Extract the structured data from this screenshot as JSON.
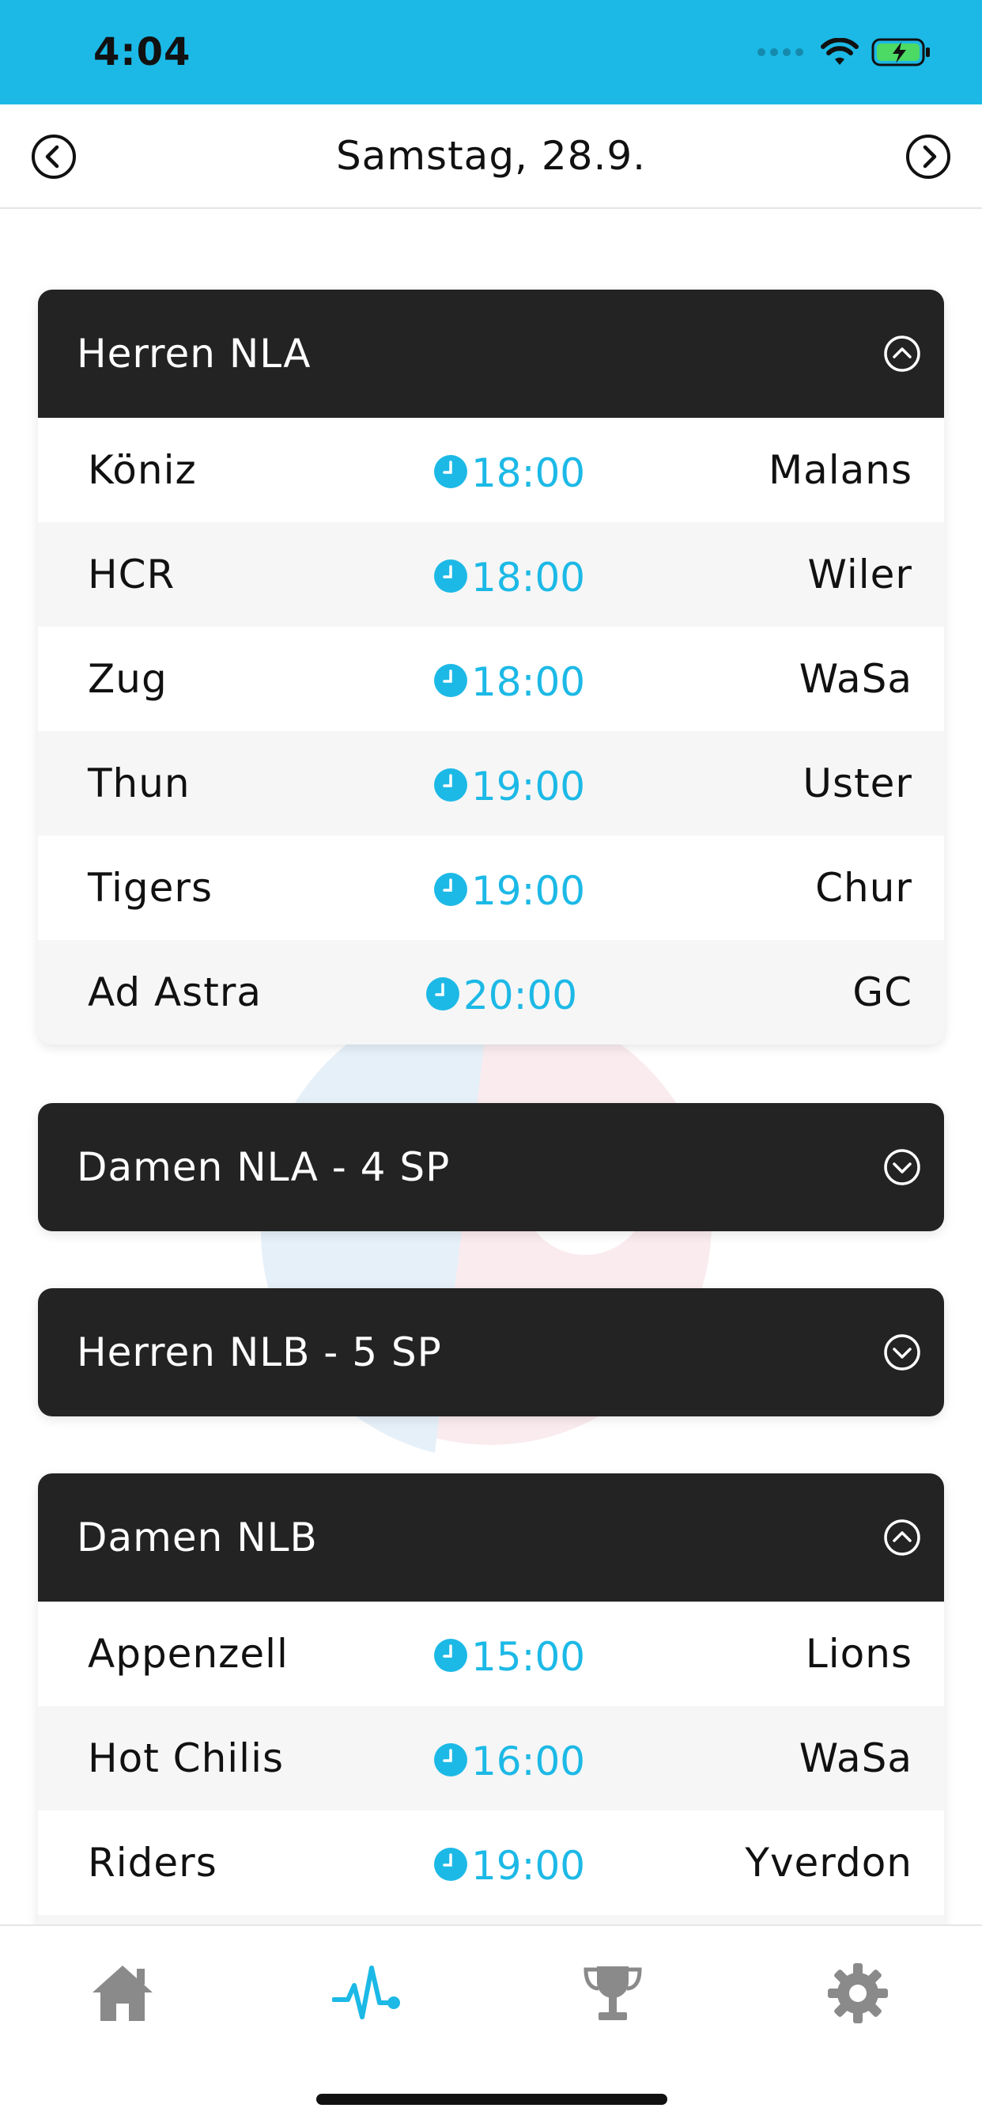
{
  "status_bar": {
    "time": "4:04",
    "icons": [
      "cellular-dots-icon",
      "wifi-icon",
      "battery-charging-icon"
    ],
    "background_color": "#1cb9e6"
  },
  "date_nav": {
    "title": "Samstag, 28.9.",
    "prev_icon": "chevron-left-circle-icon",
    "next_icon": "chevron-right-circle-icon"
  },
  "colors": {
    "accent": "#1cb9e6",
    "header_dark": "#232323",
    "inactive_tab": "#8a8a8a"
  },
  "leagues": [
    {
      "title": "Herren NLA",
      "expanded": true,
      "toggle_icon": "chevron-up-circle-icon",
      "matches": [
        {
          "home": "Köniz",
          "time": "18:00",
          "away": "Malans"
        },
        {
          "home": "HCR",
          "time": "18:00",
          "away": "Wiler"
        },
        {
          "home": "Zug",
          "time": "18:00",
          "away": "WaSa"
        },
        {
          "home": "Thun",
          "time": "19:00",
          "away": "Uster"
        },
        {
          "home": "Tigers",
          "time": "19:00",
          "away": "Chur"
        },
        {
          "home": "Ad Astra",
          "time": "20:00",
          "away": "GC"
        }
      ]
    },
    {
      "title": "Damen NLA - 4 SP",
      "expanded": false,
      "toggle_icon": "chevron-down-circle-icon",
      "matches": []
    },
    {
      "title": "Herren NLB - 5 SP",
      "expanded": false,
      "toggle_icon": "chevron-down-circle-icon",
      "matches": []
    },
    {
      "title": "Damen NLB",
      "expanded": true,
      "toggle_icon": "chevron-up-circle-icon",
      "matches": [
        {
          "home": "Appenzell",
          "time": "15:00",
          "away": "Lions"
        },
        {
          "home": "Hot Chilis",
          "time": "16:00",
          "away": "WaSa"
        },
        {
          "home": "Riders",
          "time": "19:00",
          "away": "Yverdon"
        }
      ]
    }
  ],
  "tab_bar": {
    "tabs": [
      {
        "icon": "home-icon",
        "active": false
      },
      {
        "icon": "pulse-icon",
        "active": true
      },
      {
        "icon": "trophy-icon",
        "active": false
      },
      {
        "icon": "gear-icon",
        "active": false
      }
    ]
  }
}
